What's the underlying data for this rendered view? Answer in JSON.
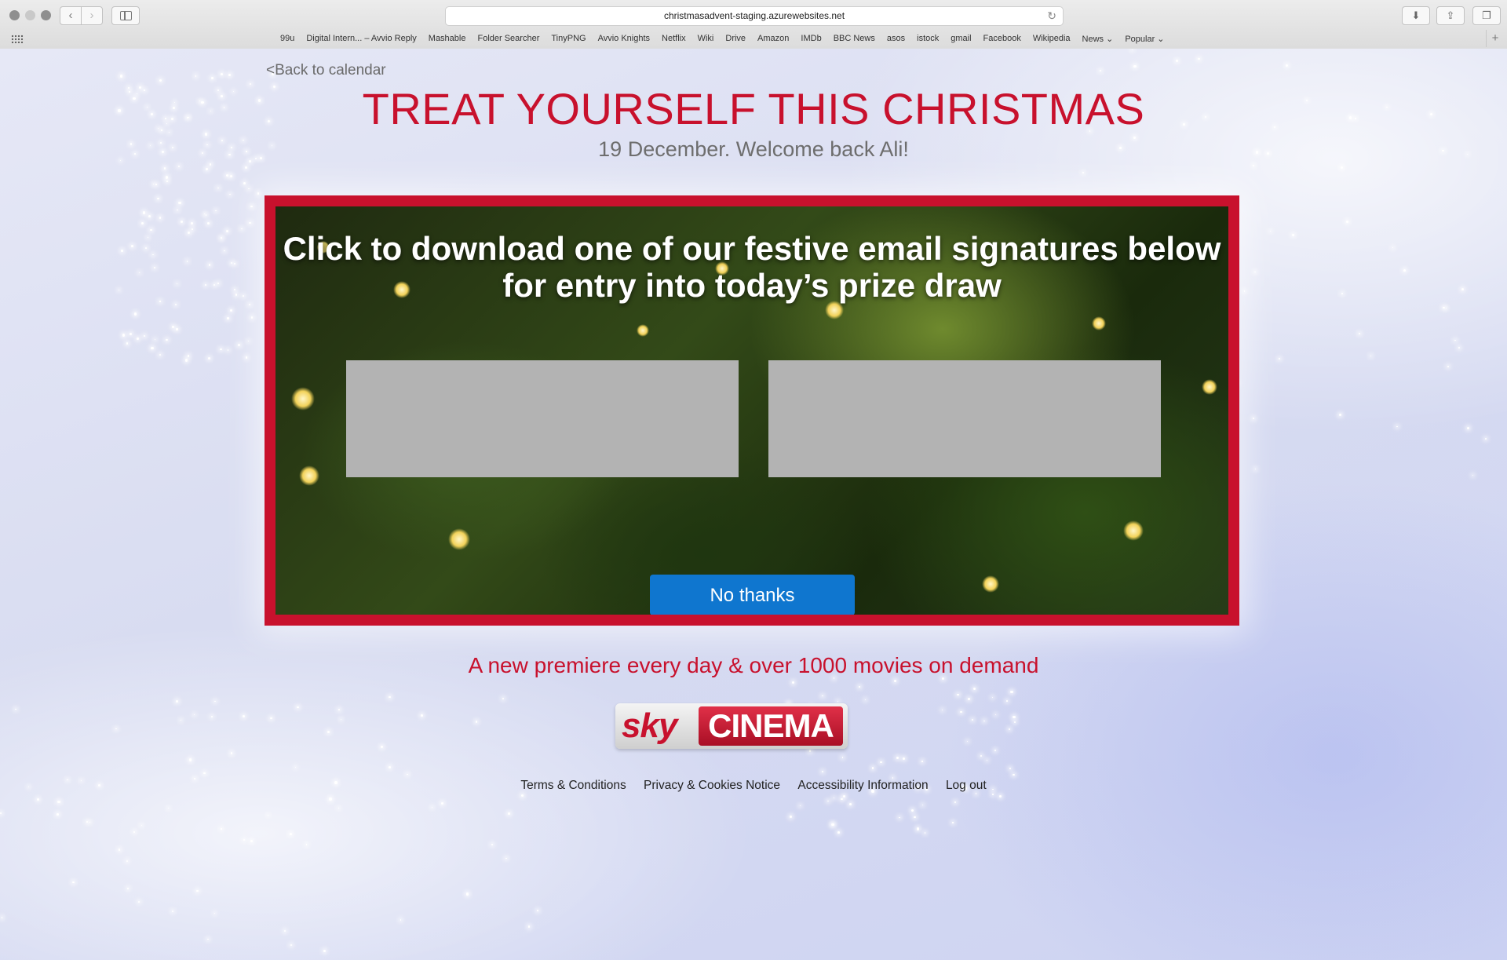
{
  "browser": {
    "url": "christmasadvent-staging.azurewebsites.net",
    "bookmarks": [
      "99u",
      "Digital Intern... – Avvio Reply",
      "Mashable",
      "Folder Searcher",
      "TinyPNG",
      "Avvio Knights",
      "Netflix",
      "Wiki",
      "Drive",
      "Amazon",
      "IMDb",
      "BBC News",
      "asos",
      "istock",
      "gmail",
      "Facebook",
      "Wikipedia",
      "News ⌄",
      "Popular ⌄"
    ]
  },
  "page": {
    "back_link": "<Back to calendar",
    "title": "TREAT YOURSELF THIS CHRISTMAS",
    "subtitle": "19 December. Welcome back Ali!",
    "promo_text": "Click to download one of our festive email signatures below for entry into today’s prize draw",
    "no_thanks": "No thanks",
    "tagline": "A new premiere every day & over 1000 movies on demand",
    "logo": {
      "sky": "sky",
      "cinema": "CINEMA"
    },
    "footer_links": [
      "Terms & Conditions",
      "Privacy & Cookies Notice",
      "Accessibility Information",
      "Log out"
    ]
  },
  "colors": {
    "brand_red": "#c8112d",
    "button_blue": "#0f76cf"
  }
}
